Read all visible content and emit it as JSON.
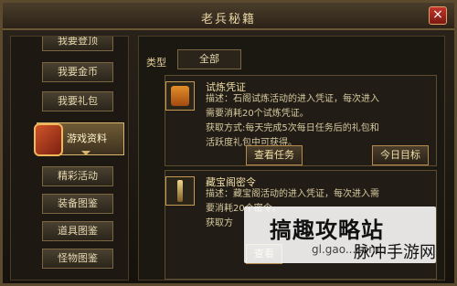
{
  "window": {
    "title": "老兵秘籍",
    "close_icon": "close-icon"
  },
  "sidebar": {
    "items": [
      {
        "label": "我要登顶",
        "active": false
      },
      {
        "label": "我要金币",
        "active": false
      },
      {
        "label": "我要礼包",
        "active": false
      },
      {
        "label": "游戏资料",
        "active": true
      },
      {
        "label": "精彩活动",
        "active": false
      },
      {
        "label": "装备图鉴",
        "active": false
      },
      {
        "label": "道具图鉴",
        "active": false
      },
      {
        "label": "怪物图鉴",
        "active": false
      }
    ]
  },
  "filter": {
    "label": "类型",
    "selected": "全部"
  },
  "items": [
    {
      "name": "试炼凭证",
      "icon": "certificate-icon",
      "desc1": "描述：石阁试炼活动的进入凭证，每次进入",
      "desc2": "需要消耗20个试炼凭证。",
      "source1": "获取方式:每天完成5次每日任务后的礼包和",
      "source2": "活跃度礼包中可获得。",
      "btn_left": "查看任务",
      "btn_right": "今日目标"
    },
    {
      "name": "藏宝阁密令",
      "icon": "sword-icon",
      "desc1": "描述：藏宝阁活动的进入凭证，每次进入需",
      "desc2": "要消耗20个密令。",
      "source1": "获取方",
      "btn_left": "查看"
    }
  ],
  "watermark": {
    "title": "搞趣攻略站",
    "sub": "gl.gao...com",
    "brand": "脉冲手游网"
  }
}
